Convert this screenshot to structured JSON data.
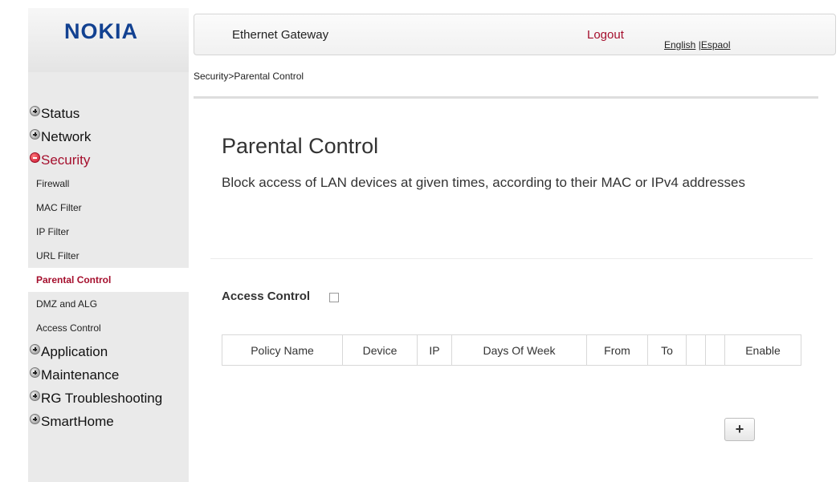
{
  "brand": {
    "logo": "NOKIA",
    "logo_color": "#124191"
  },
  "header": {
    "title": "Ethernet Gateway",
    "logout": "Logout",
    "lang_english": "English",
    "lang_sep": " |",
    "lang_espanol": "Espaol"
  },
  "breadcrumb": "Security>Parental Control",
  "sidebar": {
    "items": [
      {
        "label": "Status",
        "icon": "plus-icon"
      },
      {
        "label": "Network",
        "icon": "plus-icon"
      },
      {
        "label": "Security",
        "icon": "minus-icon"
      },
      {
        "label": "Firewall"
      },
      {
        "label": "MAC Filter"
      },
      {
        "label": "IP Filter"
      },
      {
        "label": "URL Filter"
      },
      {
        "label": "Parental Control"
      },
      {
        "label": "DMZ and ALG"
      },
      {
        "label": "Access Control"
      },
      {
        "label": "Application",
        "icon": "plus-icon"
      },
      {
        "label": "Maintenance",
        "icon": "plus-icon"
      },
      {
        "label": "RG Troubleshooting",
        "icon": "plus-icon"
      },
      {
        "label": "SmartHome",
        "icon": "plus-icon"
      }
    ]
  },
  "main": {
    "title": "Parental Control",
    "description": "Block access of LAN devices at given times, according to their MAC or IPv4 addresses",
    "access_control_label": "Access Control",
    "access_control_checked": false,
    "table": {
      "columns": [
        "Policy Name",
        "Device",
        "IP",
        "Days Of Week",
        "From",
        "To",
        "",
        "",
        "Enable"
      ]
    },
    "add_button": "+"
  },
  "colors": {
    "accent": "#a50f2d",
    "sidebar_bg": "#eaeaea"
  }
}
